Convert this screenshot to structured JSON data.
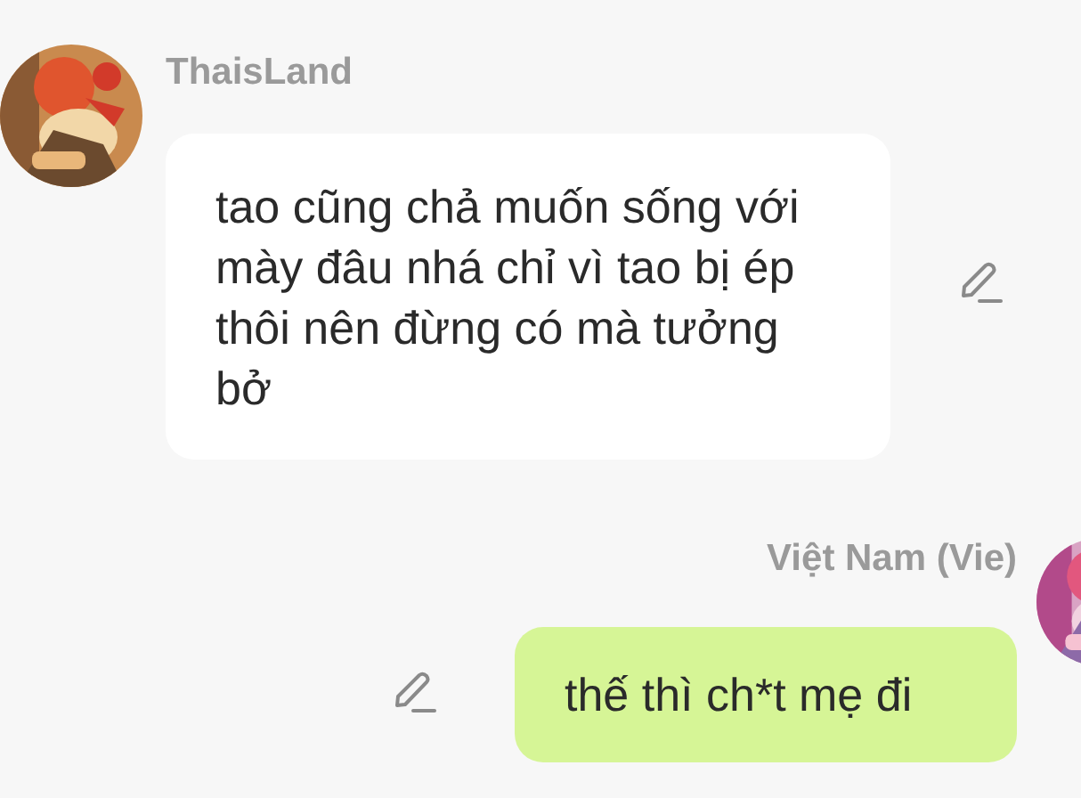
{
  "messages": [
    {
      "kind": "incoming",
      "sender": "ThaisLand",
      "text": "tao cũng chả muốn sống với mày đâu nhá chỉ vì tao bị ép thôi nên đừng có mà tưởng bở"
    },
    {
      "kind": "outgoing",
      "sender": "Việt Nam (Vie)",
      "text": "thế thì ch*t mẹ đi"
    }
  ]
}
